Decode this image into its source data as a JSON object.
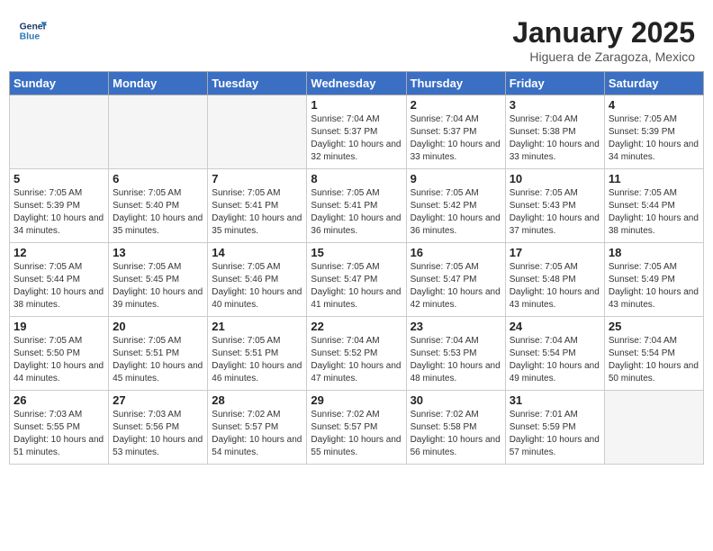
{
  "header": {
    "logo_line1": "General",
    "logo_line2": "Blue",
    "title": "January 2025",
    "subtitle": "Higuera de Zaragoza, Mexico"
  },
  "weekdays": [
    "Sunday",
    "Monday",
    "Tuesday",
    "Wednesday",
    "Thursday",
    "Friday",
    "Saturday"
  ],
  "weeks": [
    [
      {
        "day": "",
        "empty": true
      },
      {
        "day": "",
        "empty": true
      },
      {
        "day": "",
        "empty": true
      },
      {
        "day": "1",
        "sunrise": "7:04 AM",
        "sunset": "5:37 PM",
        "daylight": "10 hours and 32 minutes."
      },
      {
        "day": "2",
        "sunrise": "7:04 AM",
        "sunset": "5:37 PM",
        "daylight": "10 hours and 33 minutes."
      },
      {
        "day": "3",
        "sunrise": "7:04 AM",
        "sunset": "5:38 PM",
        "daylight": "10 hours and 33 minutes."
      },
      {
        "day": "4",
        "sunrise": "7:05 AM",
        "sunset": "5:39 PM",
        "daylight": "10 hours and 34 minutes."
      }
    ],
    [
      {
        "day": "5",
        "sunrise": "7:05 AM",
        "sunset": "5:39 PM",
        "daylight": "10 hours and 34 minutes."
      },
      {
        "day": "6",
        "sunrise": "7:05 AM",
        "sunset": "5:40 PM",
        "daylight": "10 hours and 35 minutes."
      },
      {
        "day": "7",
        "sunrise": "7:05 AM",
        "sunset": "5:41 PM",
        "daylight": "10 hours and 35 minutes."
      },
      {
        "day": "8",
        "sunrise": "7:05 AM",
        "sunset": "5:41 PM",
        "daylight": "10 hours and 36 minutes."
      },
      {
        "day": "9",
        "sunrise": "7:05 AM",
        "sunset": "5:42 PM",
        "daylight": "10 hours and 36 minutes."
      },
      {
        "day": "10",
        "sunrise": "7:05 AM",
        "sunset": "5:43 PM",
        "daylight": "10 hours and 37 minutes."
      },
      {
        "day": "11",
        "sunrise": "7:05 AM",
        "sunset": "5:44 PM",
        "daylight": "10 hours and 38 minutes."
      }
    ],
    [
      {
        "day": "12",
        "sunrise": "7:05 AM",
        "sunset": "5:44 PM",
        "daylight": "10 hours and 38 minutes."
      },
      {
        "day": "13",
        "sunrise": "7:05 AM",
        "sunset": "5:45 PM",
        "daylight": "10 hours and 39 minutes."
      },
      {
        "day": "14",
        "sunrise": "7:05 AM",
        "sunset": "5:46 PM",
        "daylight": "10 hours and 40 minutes."
      },
      {
        "day": "15",
        "sunrise": "7:05 AM",
        "sunset": "5:47 PM",
        "daylight": "10 hours and 41 minutes."
      },
      {
        "day": "16",
        "sunrise": "7:05 AM",
        "sunset": "5:47 PM",
        "daylight": "10 hours and 42 minutes."
      },
      {
        "day": "17",
        "sunrise": "7:05 AM",
        "sunset": "5:48 PM",
        "daylight": "10 hours and 43 minutes."
      },
      {
        "day": "18",
        "sunrise": "7:05 AM",
        "sunset": "5:49 PM",
        "daylight": "10 hours and 43 minutes."
      }
    ],
    [
      {
        "day": "19",
        "sunrise": "7:05 AM",
        "sunset": "5:50 PM",
        "daylight": "10 hours and 44 minutes."
      },
      {
        "day": "20",
        "sunrise": "7:05 AM",
        "sunset": "5:51 PM",
        "daylight": "10 hours and 45 minutes."
      },
      {
        "day": "21",
        "sunrise": "7:05 AM",
        "sunset": "5:51 PM",
        "daylight": "10 hours and 46 minutes."
      },
      {
        "day": "22",
        "sunrise": "7:04 AM",
        "sunset": "5:52 PM",
        "daylight": "10 hours and 47 minutes."
      },
      {
        "day": "23",
        "sunrise": "7:04 AM",
        "sunset": "5:53 PM",
        "daylight": "10 hours and 48 minutes."
      },
      {
        "day": "24",
        "sunrise": "7:04 AM",
        "sunset": "5:54 PM",
        "daylight": "10 hours and 49 minutes."
      },
      {
        "day": "25",
        "sunrise": "7:04 AM",
        "sunset": "5:54 PM",
        "daylight": "10 hours and 50 minutes."
      }
    ],
    [
      {
        "day": "26",
        "sunrise": "7:03 AM",
        "sunset": "5:55 PM",
        "daylight": "10 hours and 51 minutes."
      },
      {
        "day": "27",
        "sunrise": "7:03 AM",
        "sunset": "5:56 PM",
        "daylight": "10 hours and 53 minutes."
      },
      {
        "day": "28",
        "sunrise": "7:02 AM",
        "sunset": "5:57 PM",
        "daylight": "10 hours and 54 minutes."
      },
      {
        "day": "29",
        "sunrise": "7:02 AM",
        "sunset": "5:57 PM",
        "daylight": "10 hours and 55 minutes."
      },
      {
        "day": "30",
        "sunrise": "7:02 AM",
        "sunset": "5:58 PM",
        "daylight": "10 hours and 56 minutes."
      },
      {
        "day": "31",
        "sunrise": "7:01 AM",
        "sunset": "5:59 PM",
        "daylight": "10 hours and 57 minutes."
      },
      {
        "day": "",
        "empty": true
      }
    ]
  ]
}
